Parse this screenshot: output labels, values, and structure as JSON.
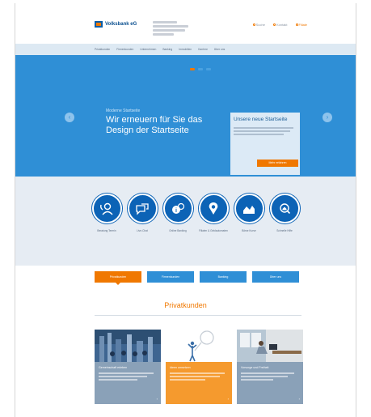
{
  "header": {
    "logo_text": "Volksbank eG",
    "logo_sub": "",
    "links": [
      "Suche",
      "Kontakt",
      "Filiale"
    ]
  },
  "nav": {
    "items": [
      "Privatkunden",
      "Firmenkunden",
      "Unternehmen",
      "Banking",
      "Immobilien",
      "Karriere",
      "Über uns"
    ]
  },
  "hero": {
    "kicker": "Moderne Startseite",
    "title": "Wir erneuern für Sie das Design der Startseite",
    "teaser_title": "Unsere neue Startseite",
    "teaser_button": "Mehr erfahren"
  },
  "services": [
    {
      "label": "Beratung Termin",
      "icon": "phone-person-icon"
    },
    {
      "label": "Live-Chat",
      "icon": "chat-bubble-icon"
    },
    {
      "label": "Online Banking",
      "icon": "info-bubble-icon"
    },
    {
      "label": "Filialen & Geldautomaten",
      "icon": "location-pin-icon"
    },
    {
      "label": "Börse Kurse",
      "icon": "chart-icon"
    },
    {
      "label": "Schnelle Hilfe",
      "icon": "magnify-house-icon"
    }
  ],
  "tabs": [
    "Privatkunden",
    "Firmenkunden",
    "Banking",
    "Über uns"
  ],
  "section_title": "Privatkunden",
  "cards": [
    {
      "head": "Gemeinschaft erleben",
      "color": "#8aa1b8"
    },
    {
      "head": "Ideen umsetzen",
      "color": "#f59a2e"
    },
    {
      "head": "Vorsorge und Freiheit",
      "color": "#8aa1b8"
    }
  ],
  "colors": {
    "brand_blue": "#2f8fd6",
    "dark_blue": "#0c63b6",
    "accent_orange": "#f07800"
  }
}
